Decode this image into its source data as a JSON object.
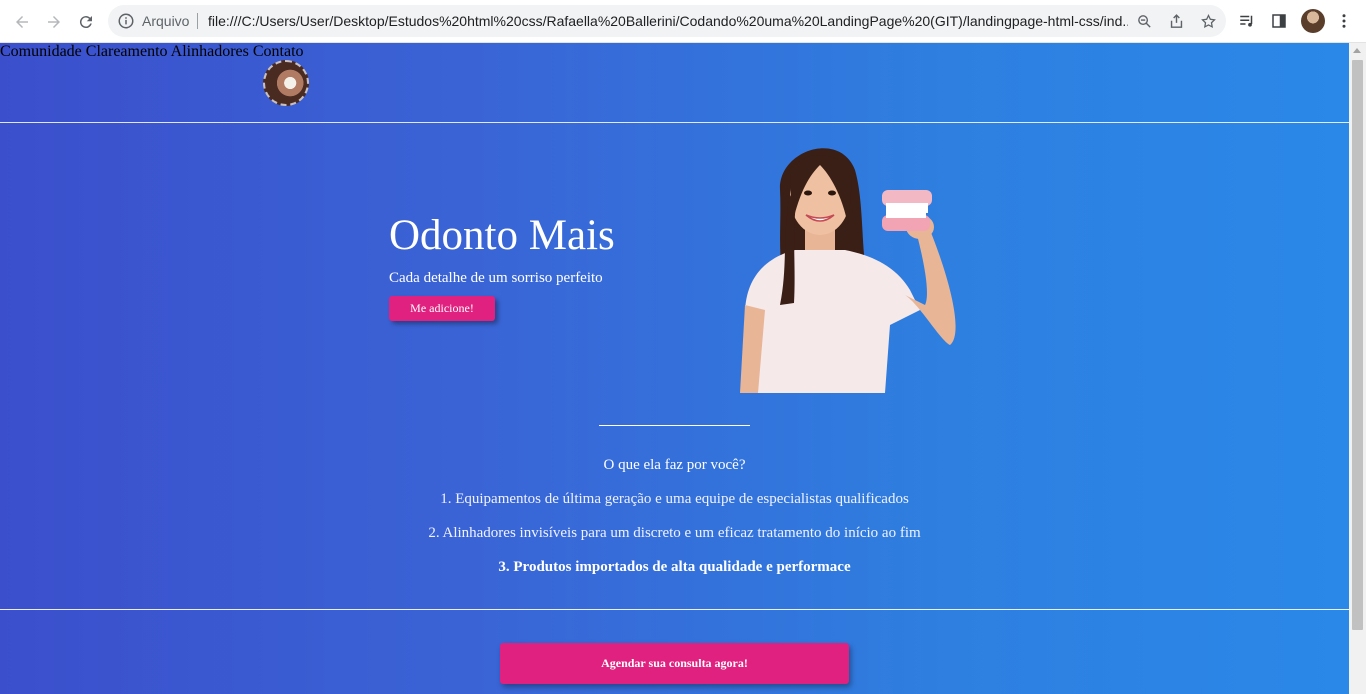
{
  "browser": {
    "omnibox_label": "Arquivo",
    "url": "file:///C:/Users/User/Desktop/Estudos%20html%20css/Rafaella%20Ballerini/Codando%20uma%20LandingPage%20(GIT)/landingpage-html-css/ind...",
    "icons": [
      "back-icon",
      "forward-icon",
      "reload-icon",
      "info-icon",
      "zoom-icon",
      "share-icon",
      "star-icon",
      "reading-list-icon",
      "side-panel-icon",
      "menu-icon"
    ]
  },
  "site": {
    "nav": [
      "Comunidade",
      "Clareamento",
      "Alinhadores",
      "Contato"
    ],
    "hero": {
      "title": "Odonto Mais",
      "subtitle": "Cada detalhe de um sorriso perfeito",
      "button": "Me adicione!"
    },
    "benefits": {
      "title": "O que ela faz por você?",
      "items": [
        "1. Equipamentos de última geração e uma equipe de especialistas qualificados",
        "2. Alinhadores invisíveis para um discreto e um eficaz tratamento do início ao fim",
        "3. Produtos importados de alta qualidade e performace"
      ]
    },
    "cta": "Agendar sua consulta agora!"
  },
  "colors": {
    "gradient_start": "#3b4fcc",
    "gradient_end": "#2a88e8",
    "accent_pink": "#e0217f"
  }
}
